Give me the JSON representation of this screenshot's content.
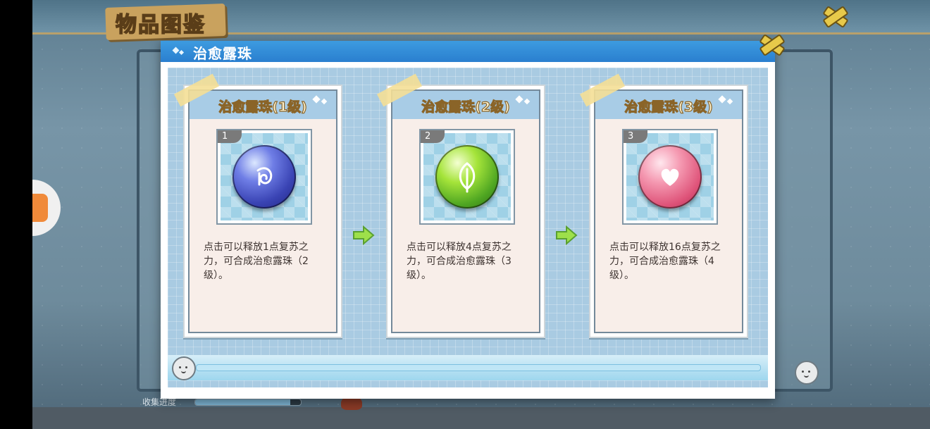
{
  "background": {
    "page_title": "物品图鉴",
    "progress_label": "收集进度",
    "progress_fraction": 0.9
  },
  "dialog": {
    "title": "治愈露珠",
    "close_icon": "cross-close-icon"
  },
  "cards": [
    {
      "number": "1",
      "title": "治愈露珠(1级)",
      "description": "点击可以释放1点复苏之力，可合成治愈露珠（2级）。",
      "orb_color": "#3a44b4",
      "symbol": "swirl-icon"
    },
    {
      "number": "2",
      "title": "治愈露珠(2级)",
      "description": "点击可以释放4点复苏之力，可合成治愈露珠（3级）。",
      "orb_color": "#4fa622",
      "symbol": "leaf-icon"
    },
    {
      "number": "3",
      "title": "治愈露珠(3级)",
      "description": "点击可以释放16点复苏之力，可合成治愈露珠（4级）。",
      "orb_color": "#de5278",
      "symbol": "heart-icon"
    }
  ],
  "colors": {
    "header_blue": "#2a7fcf",
    "card_head": "#a8cce6",
    "arrow_green": "#9ee04a"
  }
}
